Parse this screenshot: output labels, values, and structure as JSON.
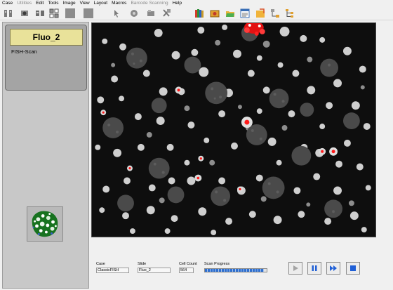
{
  "menu": [
    {
      "label": "Case",
      "enabled": true
    },
    {
      "label": "Utilities",
      "enabled": false
    },
    {
      "label": "Edit",
      "enabled": true
    },
    {
      "label": "Tools",
      "enabled": true
    },
    {
      "label": "Image",
      "enabled": true
    },
    {
      "label": "View",
      "enabled": true
    },
    {
      "label": "Layout",
      "enabled": true
    },
    {
      "label": "Macros",
      "enabled": true
    },
    {
      "label": "Barcode Scanning",
      "enabled": false
    },
    {
      "label": "Help",
      "enabled": true
    }
  ],
  "case_card": {
    "title": "Fluo_2",
    "subtitle": "FISH-Scan"
  },
  "fields": {
    "case_label": "Case",
    "case_value": "ClassicFISH",
    "slide_label": "Slide",
    "slide_value": "Fluo_2",
    "cell_count_label": "Cell Count",
    "cell_count_value": "564",
    "scan_progress_label": "Scan Progress",
    "scan_progress_fraction": 0.95
  },
  "colors": {
    "progress": "#2d6fd1",
    "card": "#e9e29a",
    "control_blue": "#1f5fd6",
    "signal_red": "#ff1a1a"
  }
}
